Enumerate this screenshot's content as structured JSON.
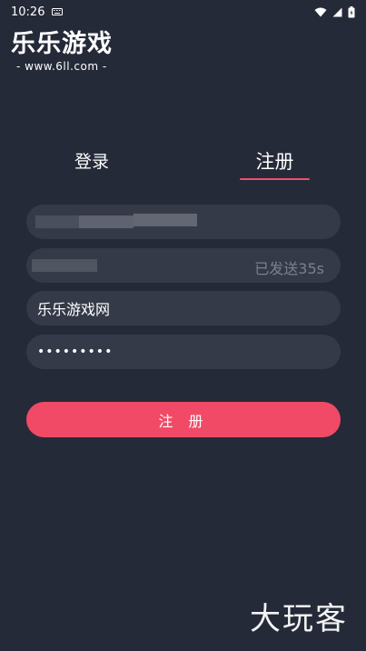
{
  "status_bar": {
    "time": "10:26",
    "icons": [
      "keyboard-icon",
      "wifi-icon",
      "signal-icon",
      "battery-icon"
    ]
  },
  "logo": {
    "title": "乐乐游戏",
    "subtitle": "- www.6ll.com -"
  },
  "tabs": [
    {
      "label": "登录",
      "active": false
    },
    {
      "label": "注册",
      "active": true
    }
  ],
  "form": {
    "phone_value": "",
    "code_value": "",
    "code_status": "已发送35s",
    "nickname_value": "乐乐游戏网",
    "password_value": "•••••••••"
  },
  "register_button_label": "注 册",
  "watermark": "大玩客",
  "colors": {
    "background": "#252a38",
    "field_bg": "#353a49",
    "accent": "#f14a66"
  }
}
